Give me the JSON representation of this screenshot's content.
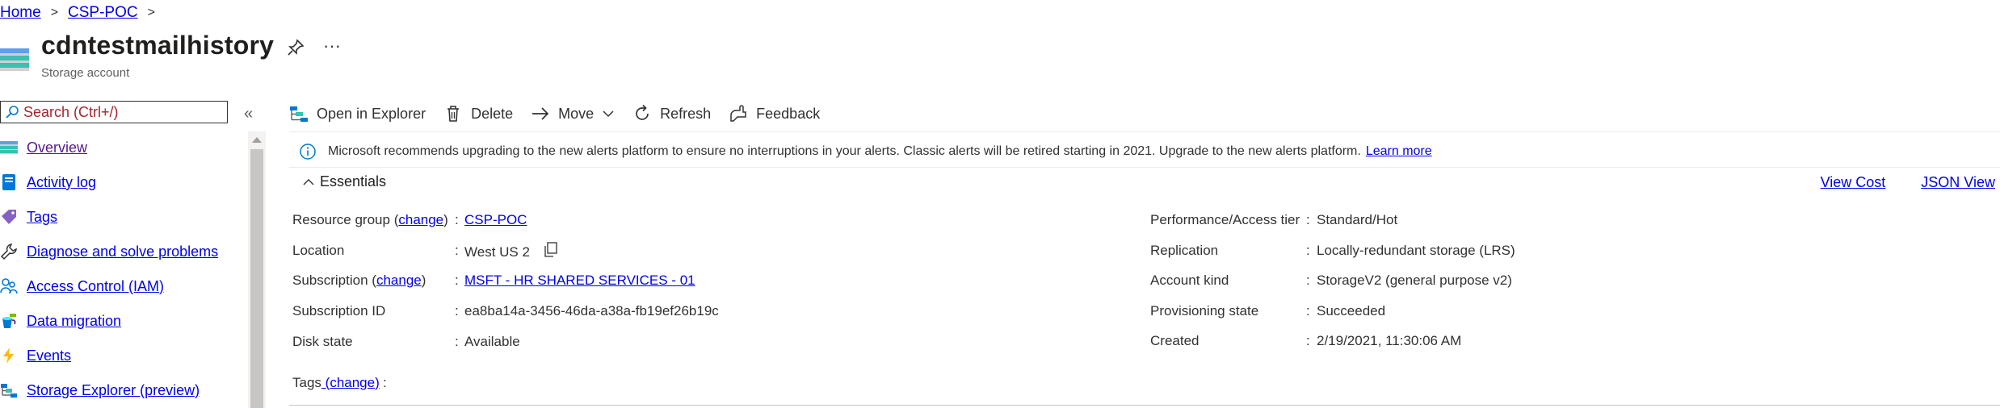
{
  "breadcrumb": {
    "home": "Home",
    "resource_group": "CSP-POC",
    "separator": ">"
  },
  "header": {
    "title": "cdntestmailhistory",
    "subtitle": "Storage account",
    "more": "···"
  },
  "search": {
    "placeholder": "Search (Ctrl+/)",
    "collapse": "«"
  },
  "sidebar": {
    "items": [
      {
        "label": "Overview",
        "icon": "overview-icon"
      },
      {
        "label": "Activity log",
        "icon": "activity-log-icon"
      },
      {
        "label": "Tags",
        "icon": "tag-icon"
      },
      {
        "label": "Diagnose and solve problems",
        "icon": "wrench-icon"
      },
      {
        "label": "Access Control (IAM)",
        "icon": "people-icon"
      },
      {
        "label": "Data migration",
        "icon": "data-migration-icon"
      },
      {
        "label": "Events",
        "icon": "lightning-icon"
      },
      {
        "label": "Storage Explorer (preview)",
        "icon": "storage-explorer-icon"
      }
    ]
  },
  "toolbar": {
    "open_explorer": "Open in Explorer",
    "delete": "Delete",
    "move": "Move",
    "refresh": "Refresh",
    "feedback": "Feedback"
  },
  "banner": {
    "text": "Microsoft recommends upgrading to the new alerts platform to ensure no interruptions in your alerts. Classic alerts will be retired starting in 2021. Upgrade to the new alerts platform.",
    "link": "Learn more"
  },
  "essentials": {
    "title": "Essentials",
    "view_cost": "View Cost",
    "json_view": "JSON View",
    "left": {
      "resource_group_label": "Resource group",
      "change": "change",
      "resource_group_value": "CSP-POC",
      "location_label": "Location",
      "location_value": "West US 2",
      "subscription_label": "Subscription",
      "subscription_value": "MSFT - HR SHARED SERVICES - 01",
      "subscription_id_label": "Subscription ID",
      "subscription_id_value": "ea8ba14a-3456-46da-a38a-fb19ef26b19c",
      "disk_state_label": "Disk state",
      "disk_state_value": "Available"
    },
    "right": {
      "perf_label": "Performance/Access tier",
      "perf_value": "Standard/Hot",
      "replication_label": "Replication",
      "replication_value": "Locally-redundant storage (LRS)",
      "kind_label": "Account kind",
      "kind_value": "StorageV2 (general purpose v2)",
      "prov_label": "Provisioning state",
      "prov_value": "Succeeded",
      "created_label": "Created",
      "created_value": "2/19/2021, 11:30:06 AM"
    },
    "tags_label": "Tags",
    "tags_change": "change",
    "colon": ":"
  }
}
